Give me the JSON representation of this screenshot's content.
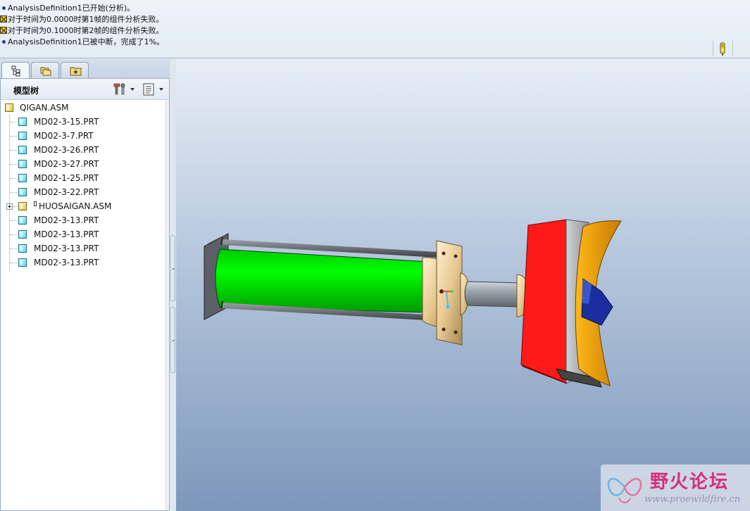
{
  "messages": [
    {
      "type": "info",
      "text": "AnalysisDefinition1已开始(分析)。"
    },
    {
      "type": "warning",
      "text": "对于时间为0.0000时第1帧的组件分析失败。"
    },
    {
      "type": "warning",
      "text": "对于时间为0.1000时第2帧的组件分析失败。"
    },
    {
      "type": "info",
      "text": "AnalysisDefinition1已被中断，完成了1%。"
    }
  ],
  "status_icon": "traffic-light-icon",
  "navigator": {
    "tabs": [
      {
        "name": "model-tree-tab",
        "icon": "model-tree-icon",
        "active": true
      },
      {
        "name": "folder-browser-tab",
        "icon": "folders-icon",
        "active": false
      },
      {
        "name": "favorites-tab",
        "icon": "favorites-folder-icon",
        "active": false
      }
    ],
    "title": "模型树",
    "settings_icon": "tools-icon",
    "show_icon": "list-icon"
  },
  "tree": {
    "root": {
      "label": "QIGAN.ASM",
      "type": "assembly"
    },
    "items": [
      {
        "label": "MD02-3-15.PRT",
        "type": "part"
      },
      {
        "label": "MD02-3-7.PRT",
        "type": "part"
      },
      {
        "label": "MD02-3-26.PRT",
        "type": "part"
      },
      {
        "label": "MD02-3-27.PRT",
        "type": "part"
      },
      {
        "label": "MD02-1-25.PRT",
        "type": "part"
      },
      {
        "label": "MD02-3-22.PRT",
        "type": "part"
      },
      {
        "label": "HUOSAIGAN.ASM",
        "type": "assembly",
        "collapsed": true
      },
      {
        "label": "MD02-3-13.PRT",
        "type": "part"
      },
      {
        "label": "MD02-3-13.PRT",
        "type": "part"
      },
      {
        "label": "MD02-3-13.PRT",
        "type": "part"
      },
      {
        "label": "MD02-3-13.PRT",
        "type": "part"
      }
    ]
  },
  "colors": {
    "cylinder_body": "#00ff00",
    "brass_flange": "#f0d8a8",
    "red_block": "#ff1a1a",
    "orange_jaw": "#f5a500",
    "blue_insert": "#1a2ea0",
    "viewport_top": "#e8eef6",
    "viewport_bottom": "#7d97bb"
  },
  "watermark": {
    "title": "野火论坛",
    "url": "www.proewildfire.cn"
  }
}
